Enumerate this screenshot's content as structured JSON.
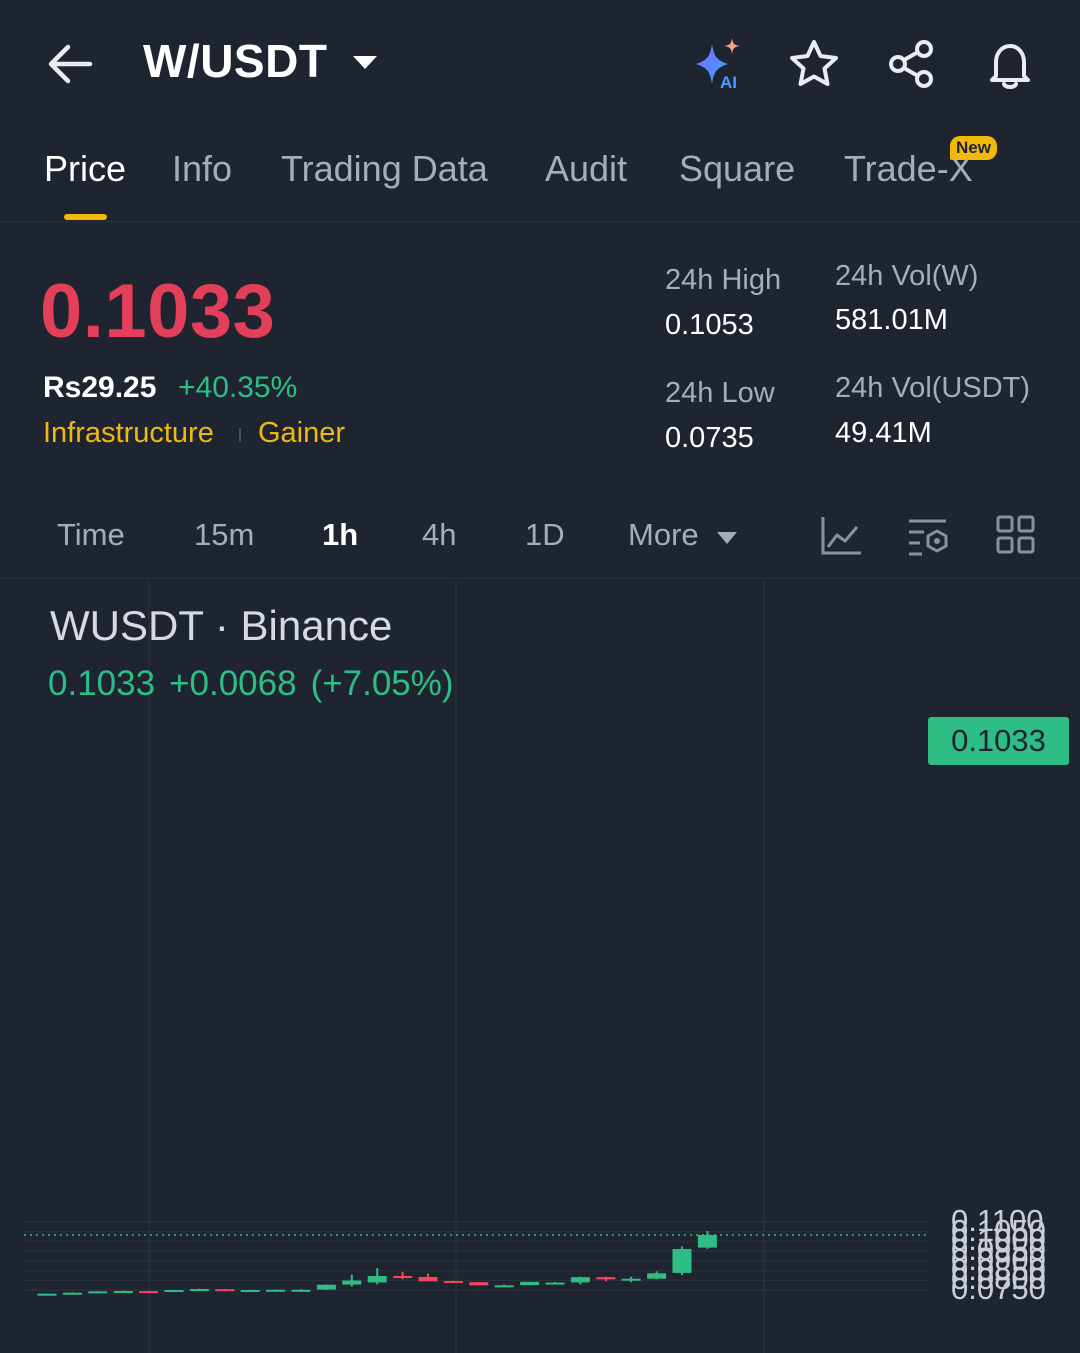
{
  "header": {
    "pair": "W/USDT",
    "icons": [
      "back-arrow-icon",
      "ai-sparkle-icon",
      "star-icon",
      "share-icon",
      "bell-icon"
    ]
  },
  "tabs": [
    {
      "label": "Price",
      "active": true
    },
    {
      "label": "Info"
    },
    {
      "label": "Trading Data"
    },
    {
      "label": "Audit"
    },
    {
      "label": "Square"
    },
    {
      "label": "Trade-X"
    }
  ],
  "new_badge": "New",
  "ticker": {
    "last_price": "0.1033",
    "fiat_price": "Rs29.25",
    "change_pct": "+40.35%",
    "tags": [
      "Infrastructure",
      "Gainer"
    ]
  },
  "stats": {
    "high_label": "24h High",
    "high_value": "0.1053",
    "low_label": "24h Low",
    "low_value": "0.0735",
    "vol_base_label": "24h Vol(W)",
    "vol_base_value": "581.01M",
    "vol_quote_label": "24h Vol(USDT)",
    "vol_quote_value": "49.41M"
  },
  "intervals": [
    {
      "label": "Time"
    },
    {
      "label": "15m"
    },
    {
      "label": "1h",
      "active": true
    },
    {
      "label": "4h"
    },
    {
      "label": "1D"
    },
    {
      "label": "More"
    }
  ],
  "colors": {
    "up": "#2ebd85",
    "down": "#f6465d",
    "accent": "#f0b90b",
    "background": "#1f2530"
  },
  "chart_data": {
    "type": "candlestick",
    "symbol_label": "WUSDT · Binance",
    "last": "0.1033",
    "change": "+0.0068",
    "change_pct": "(+7.05%)",
    "ylim": [
      0.0728,
      0.1112
    ],
    "y_ticks": [
      "0.1100",
      "0.1050",
      "0.1000",
      "0.0950",
      "0.0900",
      "0.0850",
      "0.0800",
      "0.0750"
    ],
    "current_price_label": "0.1033",
    "candles": [
      {
        "o": 0.073,
        "h": 0.0731,
        "l": 0.073,
        "c": 0.0731
      },
      {
        "o": 0.0731,
        "h": 0.0738,
        "l": 0.0731,
        "c": 0.0736
      },
      {
        "o": 0.0737,
        "h": 0.0744,
        "l": 0.0737,
        "c": 0.0743
      },
      {
        "o": 0.0744,
        "h": 0.0747,
        "l": 0.0741,
        "c": 0.0745
      },
      {
        "o": 0.0744,
        "h": 0.0745,
        "l": 0.0739,
        "c": 0.0743
      },
      {
        "o": 0.0744,
        "h": 0.075,
        "l": 0.0744,
        "c": 0.075
      },
      {
        "o": 0.075,
        "h": 0.0757,
        "l": 0.0749,
        "c": 0.0755
      },
      {
        "o": 0.0754,
        "h": 0.0755,
        "l": 0.0743,
        "c": 0.0744
      },
      {
        "o": 0.0745,
        "h": 0.0751,
        "l": 0.0742,
        "c": 0.075
      },
      {
        "o": 0.0749,
        "h": 0.0752,
        "l": 0.0748,
        "c": 0.0751
      },
      {
        "o": 0.075,
        "h": 0.0754,
        "l": 0.0748,
        "c": 0.0751
      },
      {
        "o": 0.0752,
        "h": 0.0779,
        "l": 0.075,
        "c": 0.0777
      },
      {
        "o": 0.0778,
        "h": 0.0829,
        "l": 0.0768,
        "c": 0.0799
      },
      {
        "o": 0.0789,
        "h": 0.0862,
        "l": 0.0779,
        "c": 0.0822
      },
      {
        "o": 0.0822,
        "h": 0.0844,
        "l": 0.0806,
        "c": 0.0814
      },
      {
        "o": 0.0817,
        "h": 0.0834,
        "l": 0.0795,
        "c": 0.0795
      },
      {
        "o": 0.0796,
        "h": 0.0798,
        "l": 0.0788,
        "c": 0.0788
      },
      {
        "o": 0.079,
        "h": 0.079,
        "l": 0.0774,
        "c": 0.0774
      },
      {
        "o": 0.0774,
        "h": 0.0778,
        "l": 0.0772,
        "c": 0.0774
      },
      {
        "o": 0.0775,
        "h": 0.0792,
        "l": 0.0774,
        "c": 0.0792
      },
      {
        "o": 0.0786,
        "h": 0.0791,
        "l": 0.0782,
        "c": 0.0788
      },
      {
        "o": 0.0789,
        "h": 0.0819,
        "l": 0.0779,
        "c": 0.0816
      },
      {
        "o": 0.0816,
        "h": 0.0818,
        "l": 0.0795,
        "c": 0.0805
      },
      {
        "o": 0.0804,
        "h": 0.0819,
        "l": 0.079,
        "c": 0.0808
      },
      {
        "o": 0.0808,
        "h": 0.0846,
        "l": 0.0805,
        "c": 0.0836
      },
      {
        "o": 0.0838,
        "h": 0.0974,
        "l": 0.0826,
        "c": 0.0961
      },
      {
        "o": 0.0968,
        "h": 0.1053,
        "l": 0.0962,
        "c": 0.1033
      }
    ]
  }
}
